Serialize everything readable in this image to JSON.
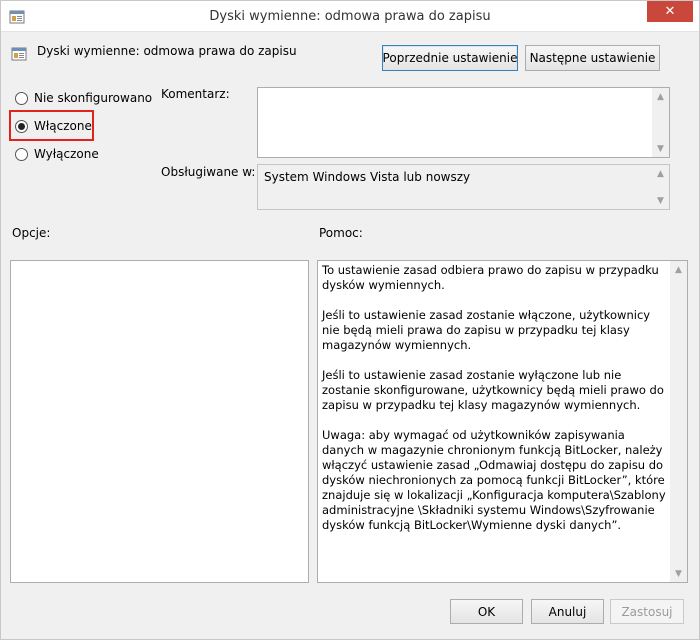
{
  "window": {
    "title": "Dyski wymienne: odmowa prawa do zapisu",
    "close_glyph": "✕"
  },
  "header": {
    "policy_name": "Dyski wymienne: odmowa prawa do zapisu",
    "prev_button": "Poprzednie ustawienie",
    "next_button": "Następne ustawienie"
  },
  "state_options": {
    "not_configured": "Nie skonfigurowano",
    "enabled": "Włączone",
    "disabled": "Wyłączone",
    "selected": "enabled"
  },
  "comment": {
    "label": "Komentarz:",
    "value": ""
  },
  "supported": {
    "label": "Obsługiwane w:",
    "value": "System Windows Vista lub nowszy"
  },
  "sections": {
    "options_label": "Opcje:",
    "help_label": "Pomoc:"
  },
  "help": {
    "paragraphs": [
      "To ustawienie zasad odbiera prawo do zapisu w przypadku dysków wymiennych.",
      "Jeśli to ustawienie zasad zostanie włączone, użytkownicy nie będą mieli prawa do zapisu w przypadku tej klasy magazynów wymiennych.",
      "Jeśli to ustawienie zasad zostanie wyłączone lub nie zostanie skonfigurowane, użytkownicy będą mieli prawo do zapisu w przypadku tej klasy magazynów wymiennych.",
      "Uwaga: aby wymagać od użytkowników zapisywania danych w magazynie chronionym funkcją BitLocker, należy włączyć ustawienie zasad „Odmawiaj dostępu do zapisu do dysków niechronionych za pomocą funkcji BitLocker”, które znajduje się w lokalizacji „Konfiguracja komputera\\Szablony administracyjne \\Składniki systemu Windows\\Szyfrowanie dysków funkcją BitLocker\\Wymienne dyski danych”."
    ]
  },
  "footer": {
    "ok": "OK",
    "cancel": "Anuluj",
    "apply": "Zastosuj"
  },
  "colors": {
    "highlight": "#e0231b",
    "close": "#c9483b"
  }
}
